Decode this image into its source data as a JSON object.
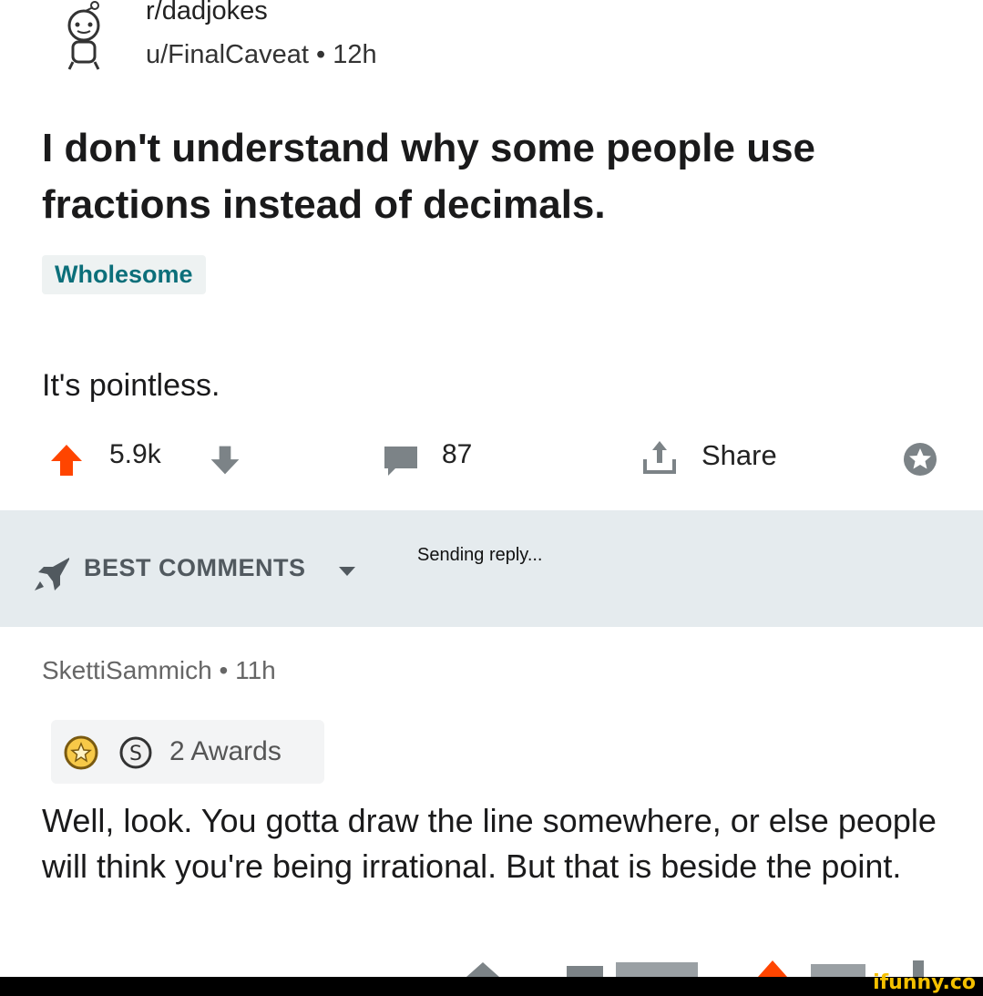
{
  "post": {
    "subreddit": "r/dadjokes",
    "user": "u/FinalCaveat",
    "age": "12h",
    "title": "I don't understand why some people use fractions instead of decimals.",
    "flair": "Wholesome",
    "body": "It's pointless."
  },
  "actions": {
    "score": "5.9k",
    "comment_count": "87",
    "share_label": "Share"
  },
  "sort": {
    "label": "BEST COMMENTS",
    "status": "Sending reply..."
  },
  "comment": {
    "author": "SkettiSammich",
    "age": "11h",
    "awards": "2 Awards",
    "text": "Well, look. You gotta draw the line somewhere, or else people will think you're being irrational. But that is beside the point."
  },
  "watermark": "ifunny.co",
  "colors": {
    "upvote": "#ff4500",
    "flair_text": "#0c6f7a",
    "bar_bg": "#e5ebee"
  }
}
